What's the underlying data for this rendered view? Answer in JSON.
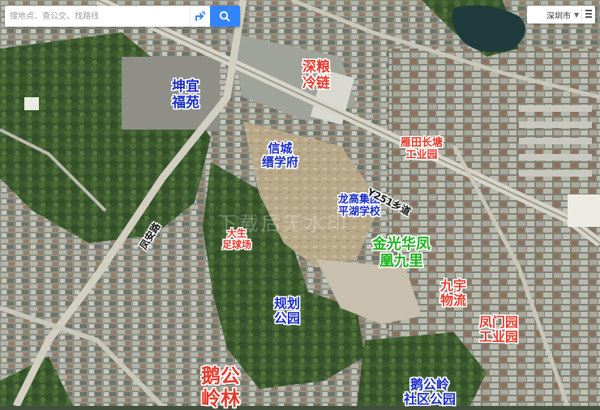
{
  "search": {
    "placeholder": "搜地点、查公交、找路线",
    "route_icon": "route-icon",
    "search_icon": "search-icon"
  },
  "city_selector": {
    "label": "深圳市",
    "chevron_icon": "chevron-down-icon",
    "menu_icon": "menu-icon"
  },
  "watermark": "下载后无水印",
  "labels": [
    {
      "id": "kunyi-fuyuan",
      "lines": [
        "坤宜",
        "福苑"
      ],
      "color": "#1a2dc4"
    },
    {
      "id": "shenliang-lenglian",
      "lines": [
        "深粮",
        "冷链"
      ],
      "color": "#e43a2b"
    },
    {
      "id": "xincheng-xixuefu",
      "lines": [
        "信城",
        "缙学府"
      ],
      "color": "#1a2dc4"
    },
    {
      "id": "yantian-changtang",
      "lines": [
        "雁田长塘",
        "工业园"
      ],
      "color": "#e43a2b"
    },
    {
      "id": "longgao-school",
      "lines": [
        "龙高集团",
        "平湖学校"
      ],
      "color": "#1a2dc4"
    },
    {
      "id": "dasheng-field",
      "lines": [
        "大生",
        "足球场"
      ],
      "color": "#e43a2b"
    },
    {
      "id": "jinguang-huafeng",
      "lines": [
        "金光华凤",
        "凰九里"
      ],
      "color": "#1fb21f"
    },
    {
      "id": "jiuyu-wuliu",
      "lines": [
        "九宇",
        "物流"
      ],
      "color": "#e43a2b"
    },
    {
      "id": "guihua-park",
      "lines": [
        "规划",
        "公园"
      ],
      "color": "#1a2dc4"
    },
    {
      "id": "fengmenyuan",
      "lines": [
        "凤门园",
        "工业园"
      ],
      "color": "#e43a2b"
    },
    {
      "id": "egong-linghu",
      "lines": [
        "鹅公",
        "岭林"
      ],
      "color": "#e43a2b"
    },
    {
      "id": "egongling-park",
      "lines": [
        "鹅公岭",
        "社区公园"
      ],
      "color": "#1a2dc4"
    }
  ],
  "roads": [
    {
      "id": "y251",
      "text": "Y251乡道"
    },
    {
      "id": "fengan",
      "text": "凤安路"
    }
  ]
}
